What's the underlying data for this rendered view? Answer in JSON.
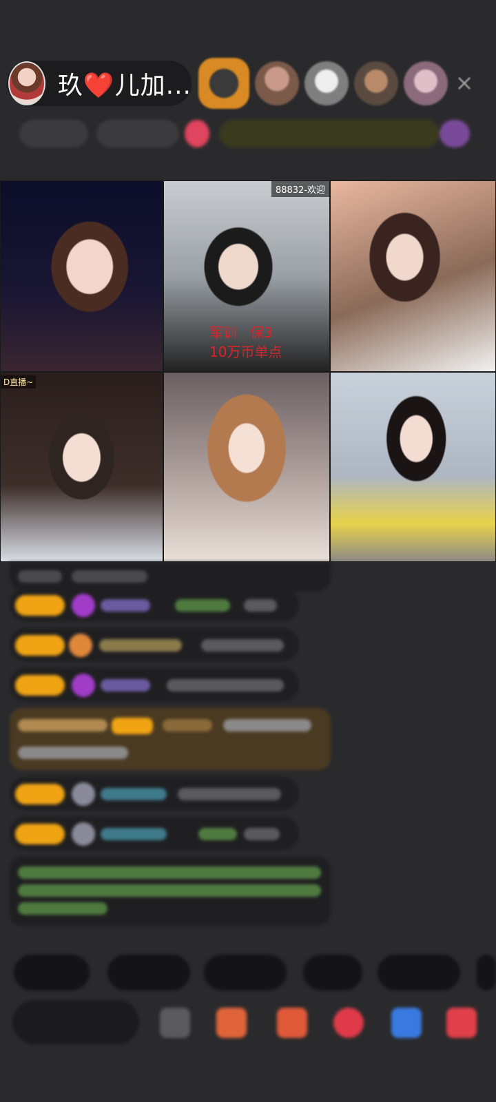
{
  "host": {
    "name_prefix": "玖",
    "heart": "❤️",
    "name_suffix": "儿加..."
  },
  "close_icon": "×",
  "grid": {
    "cell2_top_tag": "88832-欢迎",
    "cell2_overlay": "军训   保3\n10万币单点",
    "cell4_left_tag": "D直播~"
  },
  "colors": {
    "level_badge": "#f0a414",
    "overlay_red": "#e0202a",
    "panel": "#1f1f21",
    "background": "#2a2a2c"
  }
}
